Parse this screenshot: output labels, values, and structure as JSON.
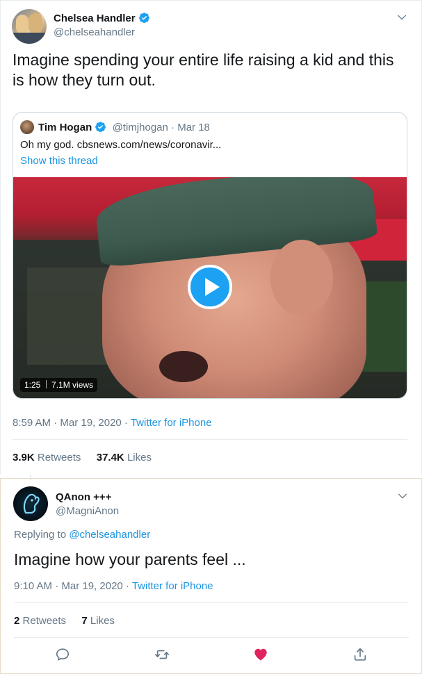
{
  "tweet1": {
    "author_name": "Chelsea Handler",
    "author_handle": "@chelseahandler",
    "text": "Imagine spending your entire life raising a kid and this is how they turn out.",
    "quote": {
      "author_name": "Tim Hogan",
      "author_handle": "@timjhogan",
      "date": "· Mar 18",
      "text": "Oh my god. cbsnews.com/news/coronavir...",
      "thread_link": "Show this thread",
      "video_duration": "1:25",
      "video_views": "7.1M views"
    },
    "time": "8:59 AM · Mar 19, 2020 ·",
    "source": "Twitter for iPhone",
    "retweets_count": "3.9K",
    "retweets_label": "Retweets",
    "likes_count": "37.4K",
    "likes_label": "Likes"
  },
  "tweet2": {
    "author_name": "QAnon +++",
    "author_handle": "@MagniAnon",
    "replying_prefix": "Replying to",
    "replying_to": "@chelseahandler",
    "text": "Imagine how your parents feel ...",
    "time": "9:10 AM · Mar 19, 2020 ·",
    "source": "Twitter for iPhone",
    "retweets_count": "2",
    "retweets_label": "Retweets",
    "likes_count": "7",
    "likes_label": "Likes"
  },
  "colors": {
    "link_blue": "#1b95e0",
    "like_red": "#e0245e",
    "muted_gray": "#657786",
    "divider": "#e6ecf0"
  },
  "icons": [
    "verified-badge-icon",
    "chevron-down-icon",
    "play-icon",
    "reply-icon",
    "retweet-icon",
    "like-heart-icon",
    "share-icon"
  ]
}
